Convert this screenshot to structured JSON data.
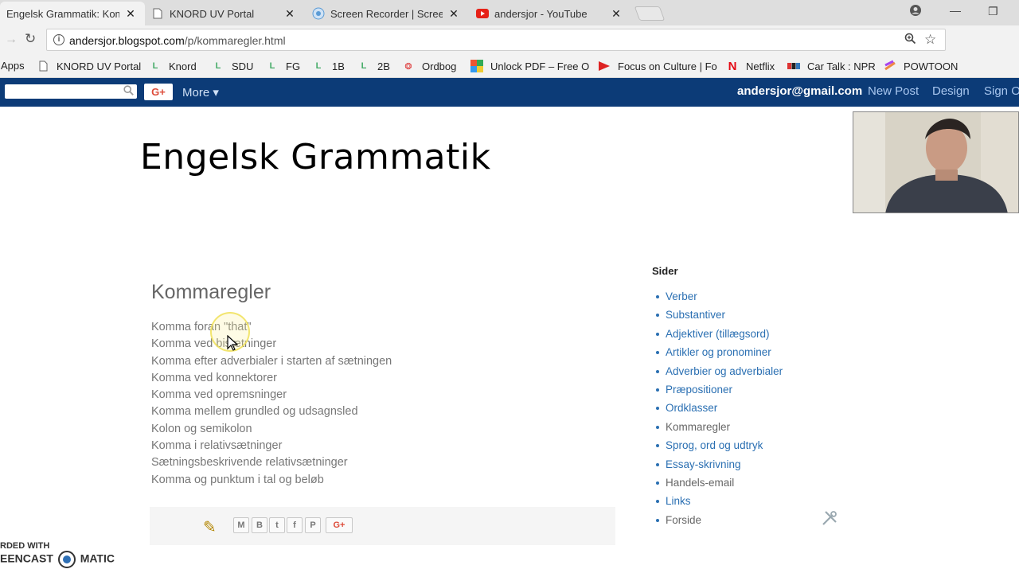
{
  "browser": {
    "tabs": [
      {
        "title": "Engelsk Grammatik: Komma",
        "active": true,
        "icon": "blogger-icon"
      },
      {
        "title": "KNORD UV Portal",
        "active": false,
        "icon": "page-icon"
      },
      {
        "title": "Screen Recorder | Screencast-O-Matic",
        "active": false,
        "icon": "screencast-icon"
      },
      {
        "title": "andersjor - YouTube",
        "active": false,
        "icon": "youtube-icon"
      }
    ],
    "url_host": "andersjor.blogspot.com",
    "url_path": "/p/kommaregler.html"
  },
  "bookmarks": [
    "Apps",
    "KNORD UV Portal",
    "Knord",
    "SDU",
    "FG",
    "1B",
    "2B",
    "Ordbog",
    "Unlock PDF – Free O",
    "Focus on Culture | Fo",
    "Netflix",
    "Car Talk : NPR",
    "POWTOON"
  ],
  "navbar": {
    "gplus": "G+",
    "more": "More ▾",
    "email": "andersjor@gmail.com",
    "new_post": "New Post",
    "design": "Design",
    "sign_out": "Sign O"
  },
  "blog": {
    "title": "Engelsk Grammatik"
  },
  "post": {
    "title": "Kommaregler",
    "items": [
      "Komma foran \"that\"",
      "Komma ved bisætninger",
      "Komma efter adverbialer i starten af sætningen",
      "Komma ved konnektorer",
      "Komma ved opremsninger",
      "Komma mellem grundled og udsagnsled",
      "Kolon og semikolon",
      "Komma i relativsætninger",
      "Sætningsbeskrivende relativsætninger",
      "Komma og punktum i tal og beløb"
    ],
    "share_gplus": "G+"
  },
  "sidebar": {
    "title": "Sider",
    "pages": [
      {
        "label": "Verber",
        "link": true
      },
      {
        "label": "Substantiver",
        "link": true
      },
      {
        "label": "Adjektiver (tillægsord)",
        "link": true
      },
      {
        "label": "Artikler og pronominer",
        "link": true
      },
      {
        "label": "Adverbier og adverbialer",
        "link": true
      },
      {
        "label": "Præpositioner",
        "link": true
      },
      {
        "label": "Ordklasser",
        "link": true
      },
      {
        "label": "Kommaregler",
        "link": false
      },
      {
        "label": "Sprog, ord og udtryk",
        "link": true
      },
      {
        "label": "Essay-skrivning",
        "link": true
      },
      {
        "label": "Handels-email",
        "link": false
      },
      {
        "label": "Links",
        "link": true
      },
      {
        "label": "Forside",
        "link": false
      }
    ]
  },
  "watermark": {
    "line1": "RDED WITH",
    "line2": "EENCAST",
    "line3": "MATIC"
  },
  "colors": {
    "navbar": "#0c3b77",
    "link": "#2a6fb2",
    "text_muted": "#777777"
  }
}
